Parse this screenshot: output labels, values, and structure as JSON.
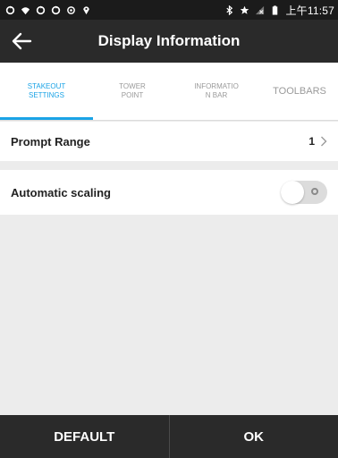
{
  "status_bar": {
    "clock": "上午11:57",
    "left_icons": [
      "sync-icon",
      "wifi-icon",
      "sync-icon",
      "sync-icon",
      "settings-icon",
      "location-icon"
    ],
    "right_icons": [
      "bluetooth-icon",
      "star-icon",
      "signal-off-icon",
      "battery-icon"
    ]
  },
  "app_bar": {
    "title": "Display Information",
    "back_icon": "arrow-left-icon"
  },
  "tabs": [
    {
      "label": "STAKEOUT\nSETTINGS",
      "active": true
    },
    {
      "label": "TOWER\nPOINT",
      "active": false
    },
    {
      "label": "INFORMATIO\nN BAR",
      "active": false
    },
    {
      "label": "TOOLBARS",
      "active": false
    }
  ],
  "settings": {
    "prompt_range": {
      "label": "Prompt Range",
      "value": "1"
    },
    "automatic_scaling": {
      "label": "Automatic scaling",
      "enabled": false
    }
  },
  "footer": {
    "default_label": "DEFAULT",
    "ok_label": "OK"
  },
  "colors": {
    "accent": "#1aa3e6",
    "bar_dark": "#2a2a2a",
    "background": "#ececec"
  }
}
